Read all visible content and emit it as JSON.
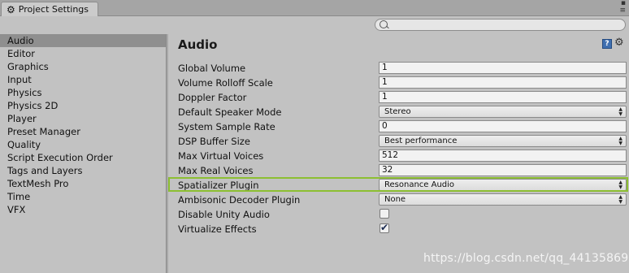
{
  "window": {
    "tab_title": "Project Settings",
    "tab_icon": "gear-icon"
  },
  "sidebar": {
    "items": [
      {
        "label": "Audio",
        "selected": true
      },
      {
        "label": "Editor"
      },
      {
        "label": "Graphics"
      },
      {
        "label": "Input"
      },
      {
        "label": "Physics"
      },
      {
        "label": "Physics 2D"
      },
      {
        "label": "Player"
      },
      {
        "label": "Preset Manager"
      },
      {
        "label": "Quality"
      },
      {
        "label": "Script Execution Order"
      },
      {
        "label": "Tags and Layers"
      },
      {
        "label": "TextMesh Pro"
      },
      {
        "label": "Time"
      },
      {
        "label": "VFX"
      }
    ]
  },
  "main": {
    "title": "Audio",
    "settings": {
      "global_volume": {
        "label": "Global Volume",
        "value": "1"
      },
      "volume_rolloff_scale": {
        "label": "Volume Rolloff Scale",
        "value": "1"
      },
      "doppler_factor": {
        "label": "Doppler Factor",
        "value": "1"
      },
      "default_speaker_mode": {
        "label": "Default Speaker Mode",
        "value": "Stereo"
      },
      "system_sample_rate": {
        "label": "System Sample Rate",
        "value": "0"
      },
      "dsp_buffer_size": {
        "label": "DSP Buffer Size",
        "value": "Best performance"
      },
      "max_virtual_voices": {
        "label": "Max Virtual Voices",
        "value": "512"
      },
      "max_real_voices": {
        "label": "Max Real Voices",
        "value": "32"
      },
      "spatializer_plugin": {
        "label": "Spatializer Plugin",
        "value": "Resonance Audio"
      },
      "ambisonic_decoder_plugin": {
        "label": "Ambisonic Decoder Plugin",
        "value": "None"
      },
      "disable_unity_audio": {
        "label": "Disable Unity Audio",
        "checked": false
      },
      "virtualize_effects": {
        "label": "Virtualize Effects",
        "checked": true
      }
    }
  },
  "overlay": {
    "watermark": "https://blog.csdn.net/qq_44135869",
    "highlight_color": "#8dbf32"
  }
}
